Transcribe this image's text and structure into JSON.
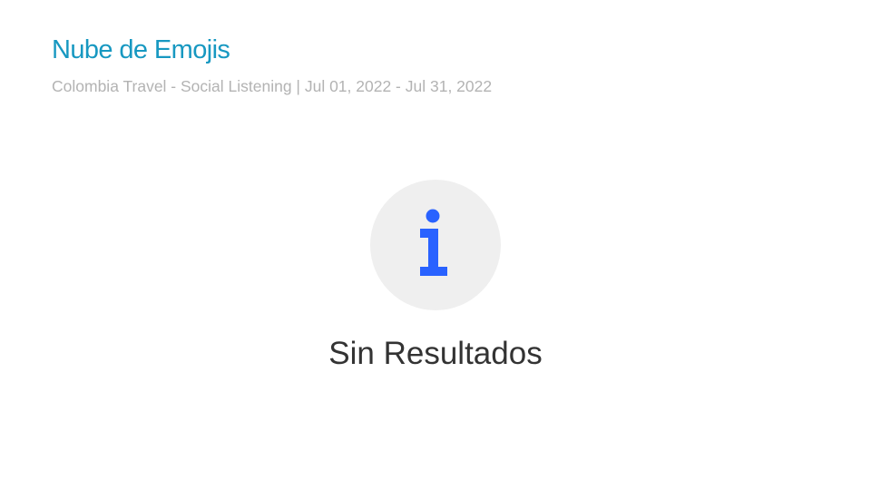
{
  "header": {
    "title": "Nube de Emojis",
    "subtitle": "Colombia Travel - Social Listening | Jul 01, 2022 - Jul 31, 2022"
  },
  "empty_state": {
    "icon": "info-icon",
    "message": "Sin Resultados"
  },
  "colors": {
    "title": "#1798c1",
    "subtitle": "#b3b3b3",
    "icon_background": "#efefef",
    "icon": "#2962ff",
    "message": "#333333"
  }
}
